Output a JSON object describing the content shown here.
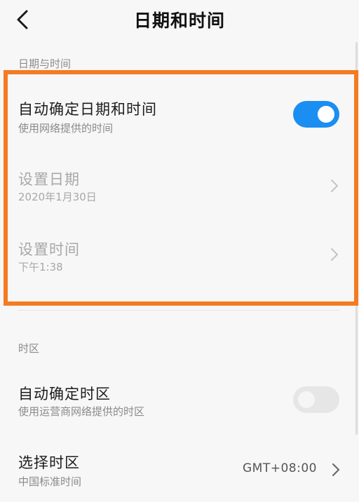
{
  "header": {
    "title": "日期和时间"
  },
  "sections": {
    "date_time_header": "日期与时间",
    "timezone_header": "时区"
  },
  "auto_datetime": {
    "title": "自动确定日期和时间",
    "subtitle": "使用网络提供的时间",
    "enabled": true
  },
  "set_date": {
    "title": "设置日期",
    "value": "2020年1月30日"
  },
  "set_time": {
    "title": "设置时间",
    "value": "下午1:38"
  },
  "auto_timezone": {
    "title": "自动确定时区",
    "subtitle": "使用运营商网络提供的时区",
    "enabled": false
  },
  "select_timezone": {
    "title": "选择时区",
    "subtitle": "中国标准时间",
    "value": "GMT+08:00"
  },
  "colors": {
    "accent": "#1b8ef2",
    "highlight": "#f47b20"
  },
  "icons": {
    "back": "back-arrow-icon",
    "chevron": "chevron-right-icon"
  }
}
